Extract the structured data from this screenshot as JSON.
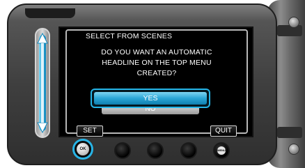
{
  "dialog": {
    "title": "SELECT FROM SCENES",
    "question_line1": "DO YOU WANT AN AUTOMATIC",
    "question_line2": "HEADLINE ON THE TOP MENU",
    "question_line3": "CREATED?",
    "options": [
      {
        "label": "YES",
        "selected": true
      },
      {
        "label": "NO",
        "selected": false
      }
    ]
  },
  "soft_buttons": {
    "set_label": "SET",
    "quit_label": "QUIT"
  },
  "hardware_buttons": {
    "ok_label": "OK",
    "menu_label": "MENU"
  },
  "colors": {
    "accent": "#28b4e6",
    "screen_background": "#000000",
    "text": "#ffffff"
  },
  "icons": {
    "scroll": "double-arrow-vertical",
    "ok": "ok-button-icon",
    "menu": "menu-button-icon"
  }
}
